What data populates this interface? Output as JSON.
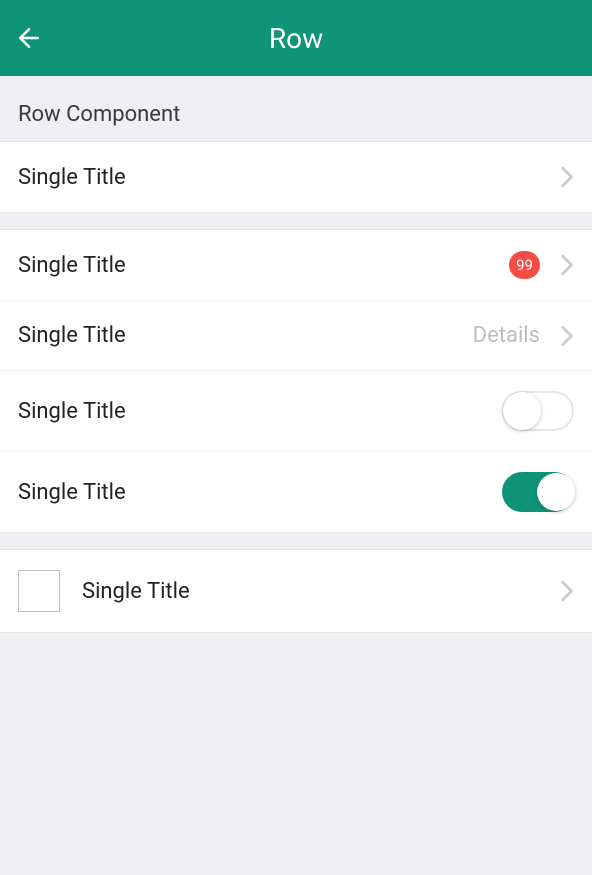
{
  "colors": {
    "accent": "#0f9478",
    "badge": "#f74b46",
    "chevron": "#c7c7cc",
    "detail": "#bdbdc2"
  },
  "header": {
    "title": "Row"
  },
  "section": {
    "title": "Row Component"
  },
  "rows": {
    "r1": {
      "title": "Single Title"
    },
    "r2": {
      "title": "Single Title",
      "badge": "99"
    },
    "r3": {
      "title": "Single Title",
      "detail": "Details"
    },
    "r4": {
      "title": "Single Title",
      "switch_on": false
    },
    "r5": {
      "title": "Single Title",
      "switch_on": true
    },
    "r6": {
      "title": "Single Title"
    }
  }
}
